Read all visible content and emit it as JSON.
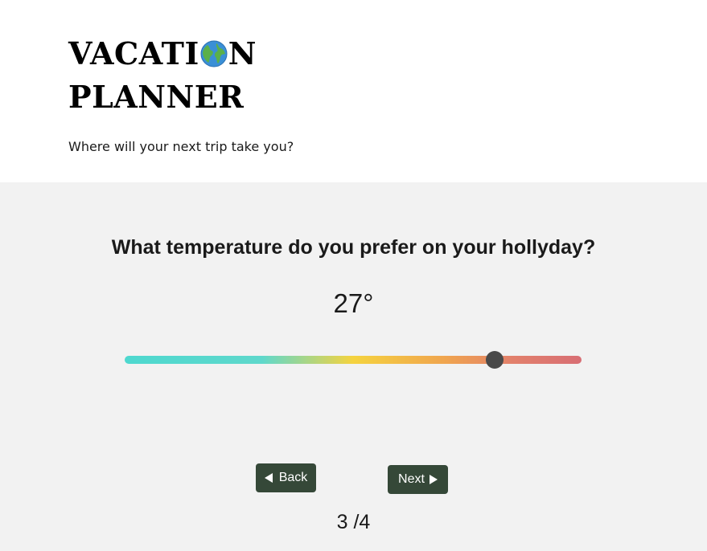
{
  "header": {
    "logo_part1": "VACATI",
    "logo_part2": "N",
    "logo_line2": "PLANNER",
    "tagline": "Where will your next trip take you?"
  },
  "question": {
    "text": "What temperature do you prefer on your hollyday?",
    "value_display": "27°"
  },
  "slider": {
    "value": 27,
    "fill_fraction": 0.81
  },
  "nav": {
    "back_label": "Back",
    "next_label": "Next"
  },
  "progress": {
    "text": "3 /4"
  },
  "colors": {
    "button_bg": "#354838",
    "page_bg": "#f2f2f2",
    "thumb": "#4a4a4a"
  },
  "icons": {
    "logo_o": "globe-icon",
    "back": "triangle-left-icon",
    "next": "triangle-right-icon"
  }
}
